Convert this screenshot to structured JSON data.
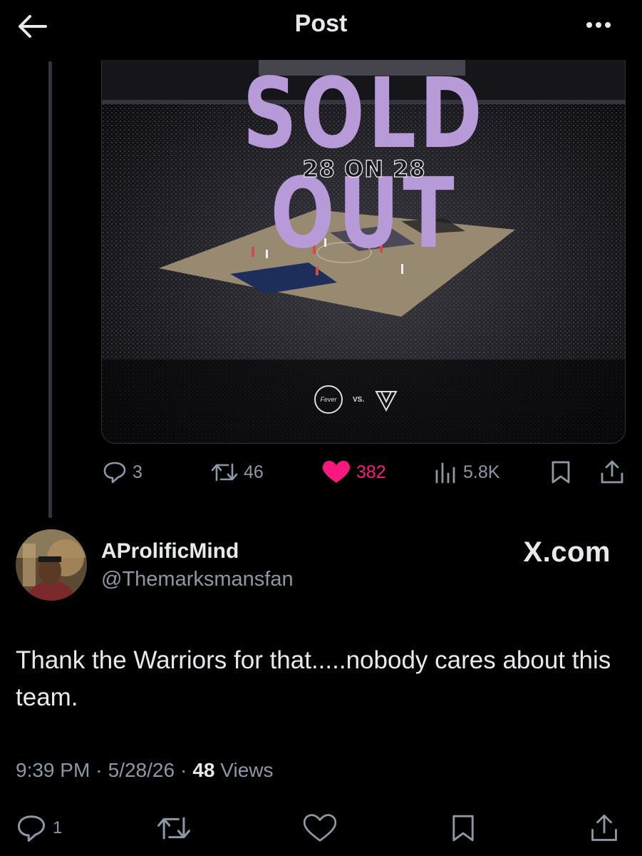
{
  "header": {
    "title": "Post",
    "back_icon": "arrow-left-icon",
    "more_icon": "more-horizontal-icon"
  },
  "media": {
    "headline": "SOLD OUT",
    "subheadline": "28 ON 28",
    "vs_label": "VS.",
    "headline_color": "#b79ad8"
  },
  "quoted_actions": {
    "replies": "3",
    "reposts": "46",
    "likes": "382",
    "views": "5.8K",
    "like_color": "#f91880"
  },
  "author": {
    "display_name": "AProlificMind",
    "handle": "@Themarksmansfan",
    "watermark": "X.com"
  },
  "tweet": {
    "text": "Thank the Warriors for that.....nobody cares about this team."
  },
  "meta": {
    "time": "9:39 PM",
    "separator1": "·",
    "date": "5/28/26",
    "separator2": "·",
    "views_count": "48",
    "views_label": "Views"
  },
  "bottom_actions": {
    "replies": "1"
  },
  "colors": {
    "background": "#000000",
    "text_primary": "#e7e9ea",
    "text_secondary": "#8b98a5"
  }
}
